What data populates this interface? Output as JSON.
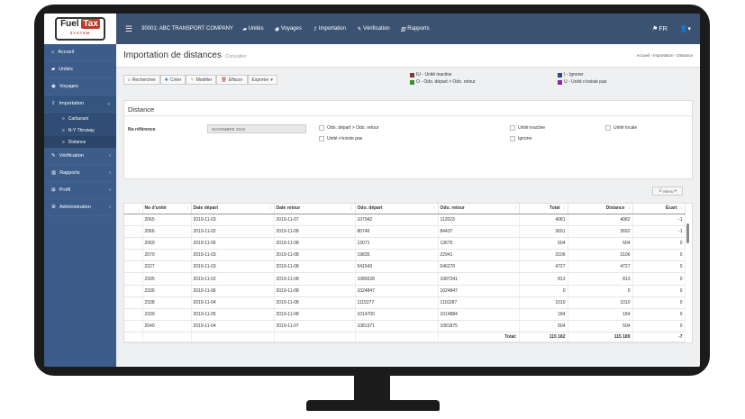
{
  "topbar": {
    "logo_fuel": "Fuel",
    "logo_tax": "Tax",
    "logo_system": "SYSTEM",
    "company": "30001: ABC TRANSPORT COMPANY",
    "nav": [
      "Unités",
      "Voyages",
      "Importation",
      "Vérification",
      "Rapports"
    ],
    "lang": "FR"
  },
  "sidebar": {
    "items": [
      "Accueil",
      "Unités",
      "Voyages",
      "Importation"
    ],
    "sub": [
      "Carburant",
      "N-Y Thruway",
      "Distance"
    ],
    "items2": [
      "Vérification",
      "Rapports",
      "Profil",
      "Administration"
    ]
  },
  "header": {
    "title": "Importation de distances",
    "subtitle": "Consulter",
    "breadcrumb": "Accueil  ›  Importation  ›  Distance"
  },
  "toolbar": {
    "rechercher": "Rechercher",
    "creer": "Créer",
    "modifier": "Modifier",
    "effacer": "Effacer",
    "exporter": "Exporter"
  },
  "legend": [
    {
      "label": "IU - Unité inactive",
      "color": "#7b3b3b"
    },
    {
      "label": "O - Odo. départ > Odo. retour",
      "color": "#3a8a3a"
    },
    {
      "label": "I - Ignorer",
      "color": "#2c4a9a"
    },
    {
      "label": "U - Unité n'existe pas",
      "color": "#8a2aa0"
    }
  ],
  "panel": {
    "title": "Distance",
    "ref_label": "No référence",
    "ref_value": "NOVEMBRE 2019",
    "filters": [
      "Odo. départ > Odo. retour",
      "Unité n'existe pas",
      "Unité inactive",
      "Ignorer",
      "Unité locale"
    ]
  },
  "menu_button": "Menu",
  "table": {
    "columns": [
      "No d'unité",
      "Date départ",
      "Date retour",
      "Odo. départ",
      "Odo. retour",
      "Total",
      "Distance",
      "Écart"
    ],
    "rows": [
      [
        "2065",
        "2019-11-03",
        "2019-11-07",
        "107942",
        "112023",
        "4081",
        "4082",
        "-1"
      ],
      [
        "2066",
        "2019-11-02",
        "2019-11-08",
        "80746",
        "84437",
        "3691",
        "3692",
        "-1"
      ],
      [
        "2069",
        "2019-11-06",
        "2019-11-08",
        "13071",
        "13675",
        "604",
        "604",
        "0"
      ],
      [
        "2070",
        "2019-11-03",
        "2019-11-08",
        "19835",
        "22941",
        "3106",
        "3106",
        "0"
      ],
      [
        "2227",
        "2019-11-03",
        "2019-11-08",
        "541543",
        "546270",
        "4727",
        "4727",
        "0"
      ],
      [
        "2335",
        "2019-11-02",
        "2019-11-08",
        "1086528",
        "1087341",
        "813",
        "813",
        "0"
      ],
      [
        "2336",
        "2019-11-06",
        "2019-11-08",
        "1024847",
        "1024847",
        "0",
        "0",
        "0"
      ],
      [
        "2338",
        "2019-11-04",
        "2019-11-08",
        "1115277",
        "1116287",
        "1010",
        "1010",
        "0"
      ],
      [
        "2339",
        "2019-11-05",
        "2019-11-08",
        "1014700",
        "1014884",
        "184",
        "184",
        "0"
      ],
      [
        "2540",
        "2019-11-04",
        "2019-11-07",
        "1081371",
        "1081875",
        "504",
        "504",
        "0"
      ]
    ],
    "footer": {
      "label": "Total:",
      "total": "115 182",
      "distance": "115 189",
      "ecart": "-7"
    }
  }
}
